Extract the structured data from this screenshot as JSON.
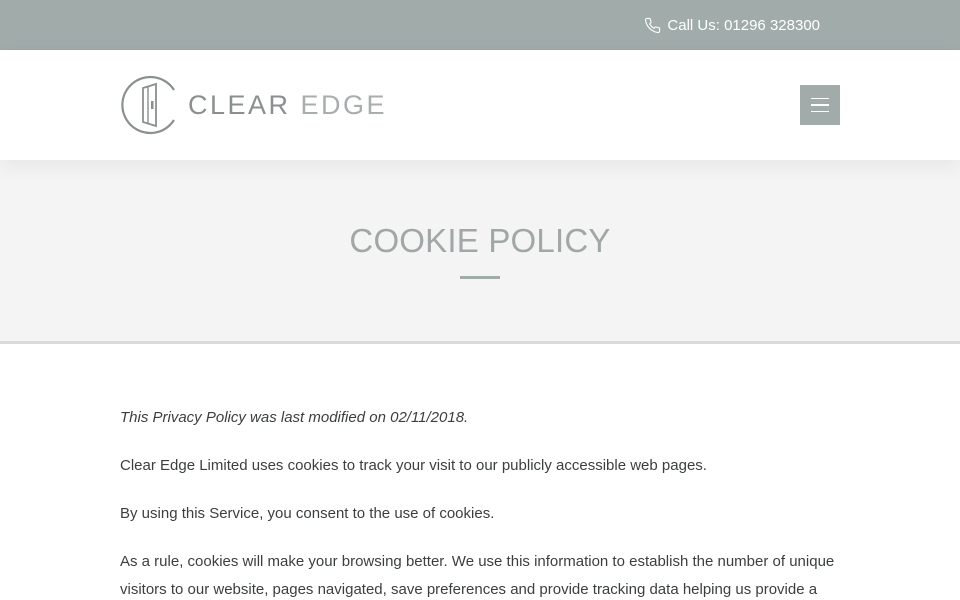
{
  "topbar": {
    "call_label": "Call Us: 01296 328300",
    "icon": "phone-icon"
  },
  "header": {
    "logo_word1": "CLEAR",
    "logo_word2": "EDGE",
    "menu_icon": "hamburger-icon"
  },
  "hero": {
    "title": "COOKIE POLICY"
  },
  "content": {
    "paragraphs": [
      "This Privacy Policy was last modified on 02/11/2018.",
      "Clear Edge Limited uses cookies to track your visit to our publicly accessible web pages.",
      "By using this Service, you consent to the use of cookies.",
      "As a rule, cookies will make your browsing better. We use this information to establish the number of unique visitors to our website, pages navigated, save preferences and provide tracking data helping us provide a"
    ]
  },
  "colors": {
    "topbar_bg": "#a1abaa",
    "hero_bg": "#f4f4f4",
    "hero_title": "#a1a6a7",
    "body_text": "#3b3f40"
  }
}
